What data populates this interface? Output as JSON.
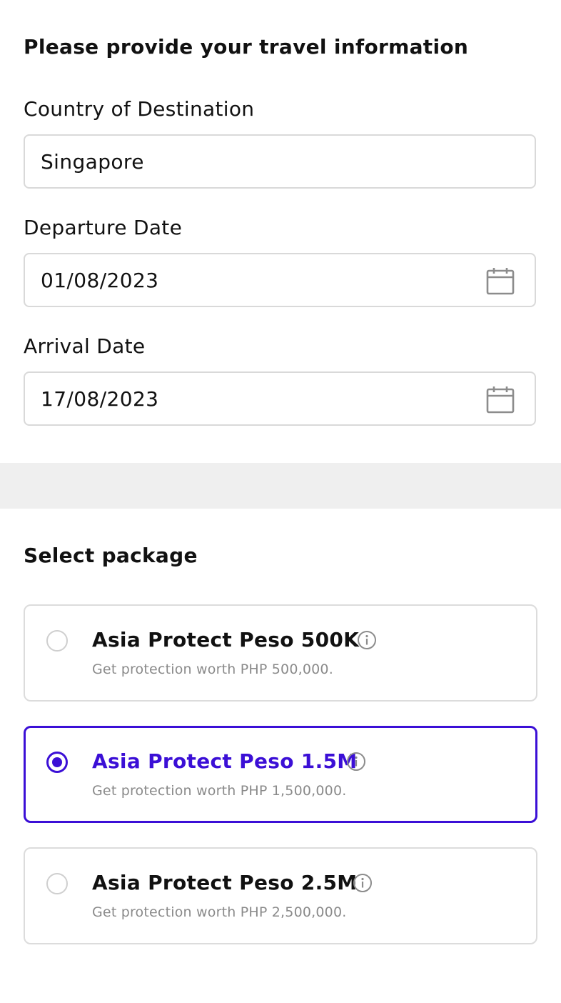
{
  "travel_info": {
    "heading": "Please provide your travel information",
    "country": {
      "label": "Country of Destination",
      "value": "Singapore"
    },
    "departure": {
      "label": "Departure Date",
      "value": "01/08/2023",
      "icon": "calendar-icon"
    },
    "arrival": {
      "label": "Arrival Date",
      "value": "17/08/2023",
      "icon": "calendar-icon"
    }
  },
  "packages": {
    "heading": "Select package",
    "accent_color": "#3b0fd6",
    "items": [
      {
        "title": "Asia Protect Peso 500K",
        "subtitle": "Get protection worth PHP 500,000.",
        "selected": false,
        "icon": "info-icon"
      },
      {
        "title": "Asia Protect Peso 1.5M",
        "subtitle": "Get protection worth PHP 1,500,000.",
        "selected": true,
        "icon": "info-icon"
      },
      {
        "title": "Asia Protect Peso 2.5M",
        "subtitle": "Get protection worth PHP 2,500,000.",
        "selected": false,
        "icon": "info-icon"
      }
    ]
  }
}
